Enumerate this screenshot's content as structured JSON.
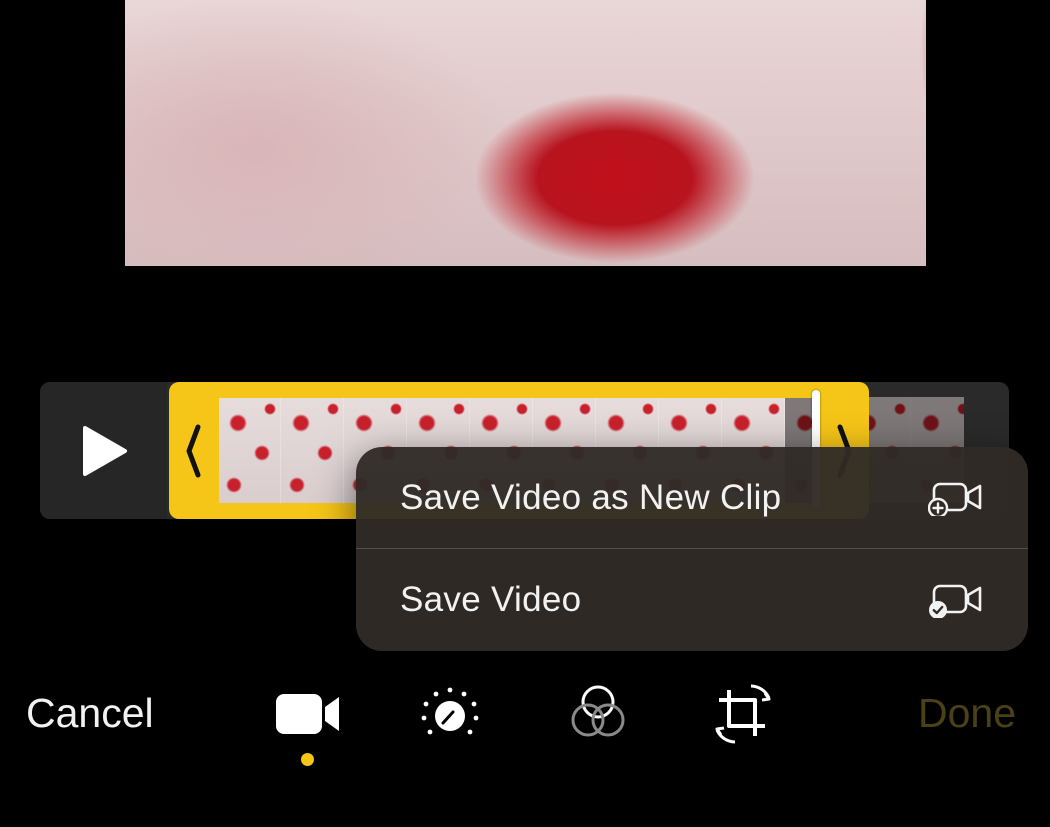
{
  "toolbar": {
    "cancel_label": "Cancel",
    "done_label": "Done",
    "tools": [
      {
        "name": "video",
        "icon": "video-camera-icon",
        "active": true
      },
      {
        "name": "adjust",
        "icon": "adjust-dial-icon",
        "active": false
      },
      {
        "name": "filters",
        "icon": "filters-circles-icon",
        "active": false
      },
      {
        "name": "crop",
        "icon": "crop-rotate-icon",
        "active": false
      }
    ]
  },
  "save_menu": {
    "items": [
      {
        "label": "Save Video as New Clip",
        "icon": "video-add-icon"
      },
      {
        "label": "Save Video",
        "icon": "video-check-icon"
      }
    ]
  },
  "timeline": {
    "play_icon": "play-icon"
  },
  "colors": {
    "accent": "#f5c518",
    "done_disabled": "#4a4116",
    "menu_background": "#302b26",
    "background": "#000000"
  }
}
